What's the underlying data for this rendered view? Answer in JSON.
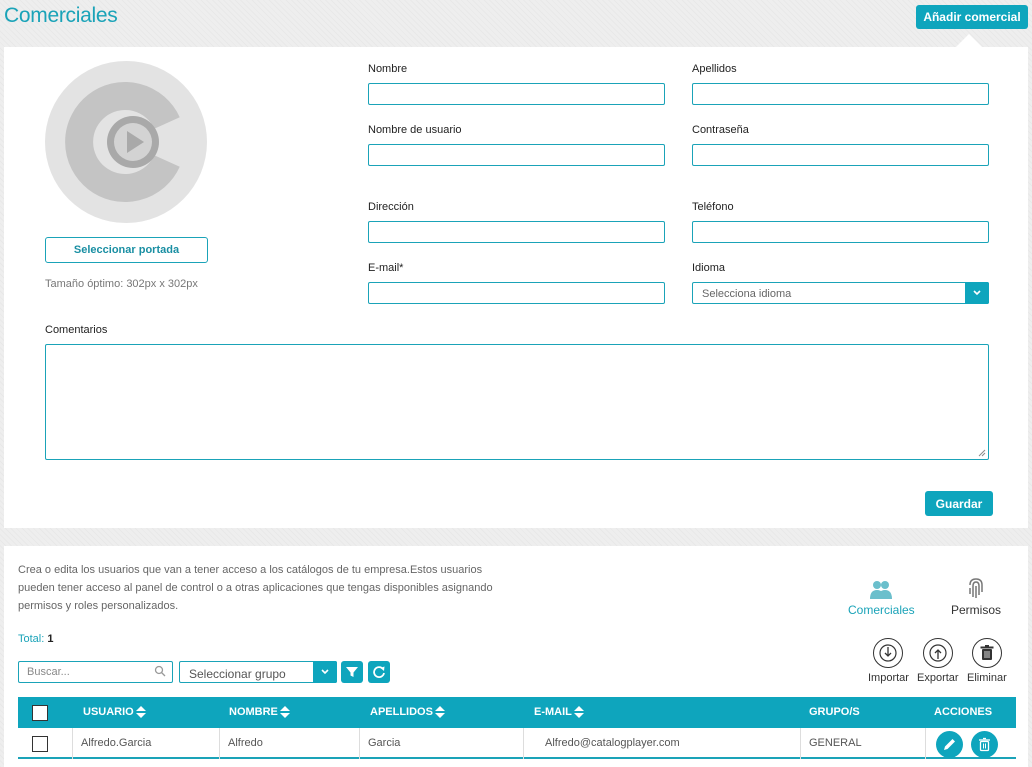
{
  "page": {
    "title": "Comerciales",
    "add_button": "Añadir comercial"
  },
  "form": {
    "cover_button": "Seleccionar portada",
    "cover_hint": "Tamaño óptimo: 302px x 302px",
    "nombre_label": "Nombre",
    "apellidos_label": "Apellidos",
    "usuario_label": "Nombre de usuario",
    "contrasena_label": "Contraseña",
    "direccion_label": "Dirección",
    "telefono_label": "Teléfono",
    "email_label": "E-mail*",
    "idioma_label": "Idioma",
    "idioma_placeholder": "Selecciona idioma",
    "comentarios_label": "Comentarios",
    "save_button": "Guardar",
    "values": {
      "nombre": "",
      "apellidos": "",
      "usuario": "",
      "contrasena": "",
      "direccion": "",
      "telefono": "",
      "email": "",
      "comentarios": ""
    }
  },
  "list": {
    "description": "Crea o edita los usuarios que van a tener acceso a los catálogos de tu empresa.Estos usuarios pueden tener acceso al panel de control o a otras aplicaciones que tengas disponibles asignando permisos y roles personalizados.",
    "total_label": "Total:",
    "total_value": "1",
    "modules": {
      "comerciales": "Comerciales",
      "permisos": "Permisos"
    },
    "search_placeholder": "Buscar...",
    "group_placeholder": "Seleccionar grupo",
    "actions": {
      "importar": "Importar",
      "exportar": "Exportar",
      "eliminar": "Eliminar"
    },
    "columns": [
      "USUARIO",
      "NOMBRE",
      "APELLIDOS",
      "E-MAIL",
      "GRUPO/S",
      "ACCIONES"
    ],
    "rows": [
      {
        "usuario": "Alfredo.Garcia",
        "nombre": "Alfredo",
        "apellidos": "Garcia",
        "email": "Alfredo@catalogplayer.com",
        "grupo": "GENERAL"
      }
    ]
  },
  "colors": {
    "accent": "#0ea5bd",
    "icon_grey": "#8c8c8c"
  },
  "icons": [
    "logo-play-icon",
    "search-icon",
    "chevron-down-icon",
    "filter-icon",
    "refresh-icon",
    "users-icon",
    "fingerprint-icon",
    "import-icon",
    "export-icon",
    "trash-icon",
    "edit-icon"
  ]
}
